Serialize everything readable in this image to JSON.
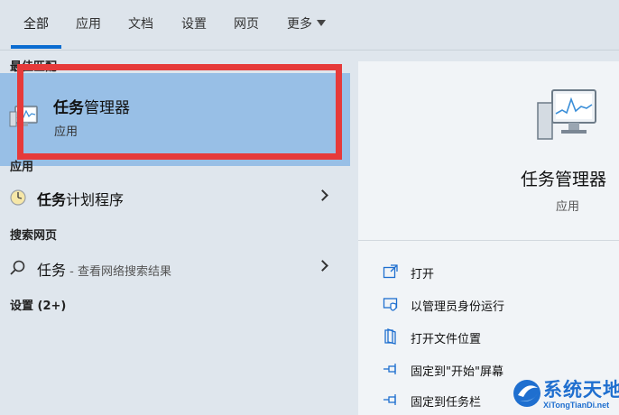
{
  "tabs": [
    {
      "label": "全部",
      "active": true
    },
    {
      "label": "应用"
    },
    {
      "label": "文档"
    },
    {
      "label": "设置"
    },
    {
      "label": "网页"
    },
    {
      "label": "更多"
    }
  ],
  "left": {
    "best_match_heading": "最佳匹配",
    "best_match": {
      "title_bold": "任务",
      "title_rest": "管理器",
      "subtitle": "应用"
    },
    "apps_heading": "应用",
    "app_item": {
      "bold": "任务",
      "rest": "计划程序"
    },
    "web_heading": "搜索网页",
    "web_item": {
      "query": "任务",
      "desc": " - 查看网络搜索结果"
    },
    "settings_heading": "设置 (2+)"
  },
  "right": {
    "app_title": "任务管理器",
    "app_type": "应用",
    "actions": [
      {
        "label": "打开",
        "icon": "open-icon"
      },
      {
        "label": "以管理员身份运行",
        "icon": "admin-shield-icon"
      },
      {
        "label": "打开文件位置",
        "icon": "file-location-icon"
      },
      {
        "label": "固定到\"开始\"屏幕",
        "icon": "pin-icon"
      },
      {
        "label": "固定到任务栏",
        "icon": "pin-icon"
      }
    ]
  },
  "watermark": {
    "main": "系统天地",
    "sub": "XiTongTianDi.net"
  },
  "colors": {
    "accent": "#0a6cd1",
    "highlight": "#98bfe6",
    "annotation": "#e63a3a"
  }
}
